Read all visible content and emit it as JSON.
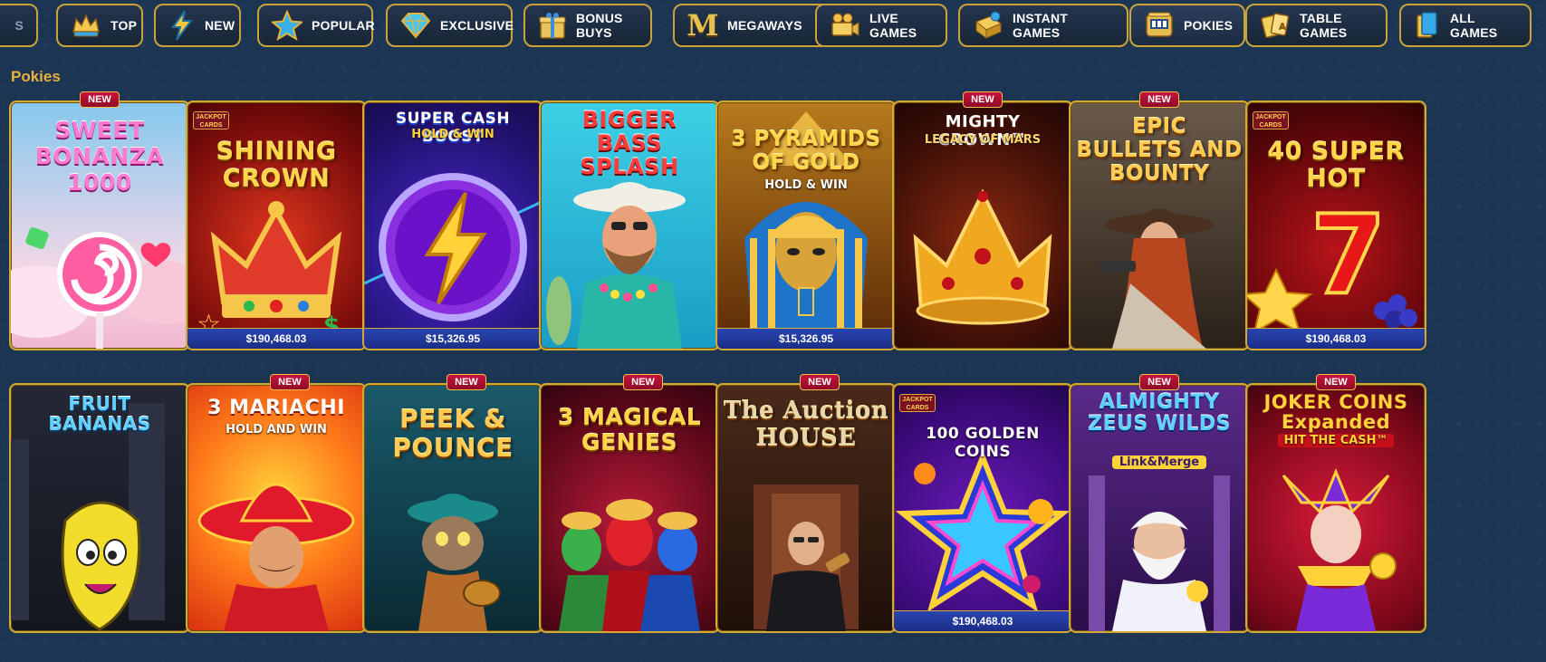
{
  "categories": [
    {
      "label": "S",
      "icon": "cut-off-category-icon",
      "active": false
    },
    {
      "label": "TOP",
      "icon": "crown-icon",
      "active": false
    },
    {
      "label": "NEW",
      "icon": "lightning-icon",
      "active": false
    },
    {
      "label": "POPULAR",
      "icon": "star-icon",
      "active": false
    },
    {
      "label": "EXCLUSIVE",
      "icon": "diamond-icon",
      "active": false
    },
    {
      "label": "BONUS BUYS",
      "icon": "gift-box-icon",
      "active": false
    },
    {
      "label": "MEGAWAYS",
      "icon": "megaways-m-icon",
      "active": false
    },
    {
      "label": "LIVE GAMES",
      "icon": "video-camera-icon",
      "active": false
    },
    {
      "label": "INSTANT GAMES",
      "icon": "instant-games-icon",
      "active": false
    },
    {
      "label": "POKIES",
      "icon": "slot-machine-icon",
      "active": true
    },
    {
      "label": "TABLE GAMES",
      "icon": "playing-cards-icon",
      "active": false
    },
    {
      "label": "ALL GAMES",
      "icon": "all-games-icon",
      "active": false
    }
  ],
  "section_title": "Pokies",
  "new_badge_label": "NEW",
  "jackpot_logo": "JACKPOT CARDS",
  "games": [
    {
      "title": "SWEET BONANZA 1000",
      "new": true,
      "jackpot": "",
      "jackpot_logo": false,
      "theme": "candy"
    },
    {
      "title": "SHINING CROWN",
      "new": false,
      "jackpot": "$190,468.03",
      "jackpot_logo": true,
      "theme": "crown-red"
    },
    {
      "title": "SUPER CASH BOOST",
      "subtitle": "HOLD & WIN",
      "new": false,
      "jackpot": "$15,326.95",
      "jackpot_logo": false,
      "theme": "lightning"
    },
    {
      "title": "BIGGER BASS SPLASH",
      "new": false,
      "jackpot": "",
      "jackpot_logo": false,
      "theme": "fisherman"
    },
    {
      "title": "3 PYRAMIDS OF GOLD",
      "subtitle": "HOLD & WIN",
      "new": false,
      "jackpot": "$15,326.95",
      "jackpot_logo": false,
      "theme": "pharaoh"
    },
    {
      "title": "MIGHTY CROWN™",
      "subtitle": "LEGACY OF MARS",
      "new": true,
      "jackpot": "",
      "jackpot_logo": false,
      "theme": "crown-dark"
    },
    {
      "title": "EPIC BULLETS AND BOUNTY",
      "new": true,
      "jackpot": "",
      "jackpot_logo": false,
      "theme": "western"
    },
    {
      "title": "40 SUPER HOT",
      "new": false,
      "jackpot": "$190,468.03",
      "jackpot_logo": true,
      "theme": "sevens"
    },
    {
      "title": "FRUIT BANANAS",
      "new": false,
      "jackpot": "",
      "jackpot_logo": false,
      "theme": "banana"
    },
    {
      "title": "3 MARIACHI",
      "subtitle": "HOLD AND WIN",
      "new": true,
      "jackpot": "",
      "jackpot_logo": false,
      "theme": "mariachi"
    },
    {
      "title": "PEEK & POUNCE",
      "new": true,
      "jackpot": "",
      "jackpot_logo": false,
      "theme": "cat"
    },
    {
      "title": "3 MAGICAL GENIES",
      "new": true,
      "jackpot": "",
      "jackpot_logo": false,
      "theme": "genies"
    },
    {
      "title": "The Auction HOUSE",
      "new": true,
      "jackpot": "",
      "jackpot_logo": false,
      "theme": "auction"
    },
    {
      "title": "100 GOLDEN COINS",
      "new": false,
      "jackpot": "$190,468.03",
      "jackpot_logo": true,
      "theme": "star"
    },
    {
      "title": "ALMIGHTY ZEUS WILDS",
      "subtitle": "Link&Merge",
      "new": true,
      "jackpot": "",
      "jackpot_logo": false,
      "theme": "zeus"
    },
    {
      "title": "JOKER COINS Expanded",
      "subtitle": "HIT THE CASH™",
      "new": true,
      "jackpot": "",
      "jackpot_logo": false,
      "theme": "joker"
    }
  ],
  "colors": {
    "background": "#1b3553",
    "gold_border": "#d6a933",
    "section_title": "#e9b23c",
    "new_badge": "#c8123b",
    "jackpot_bar": "#2944b0"
  }
}
